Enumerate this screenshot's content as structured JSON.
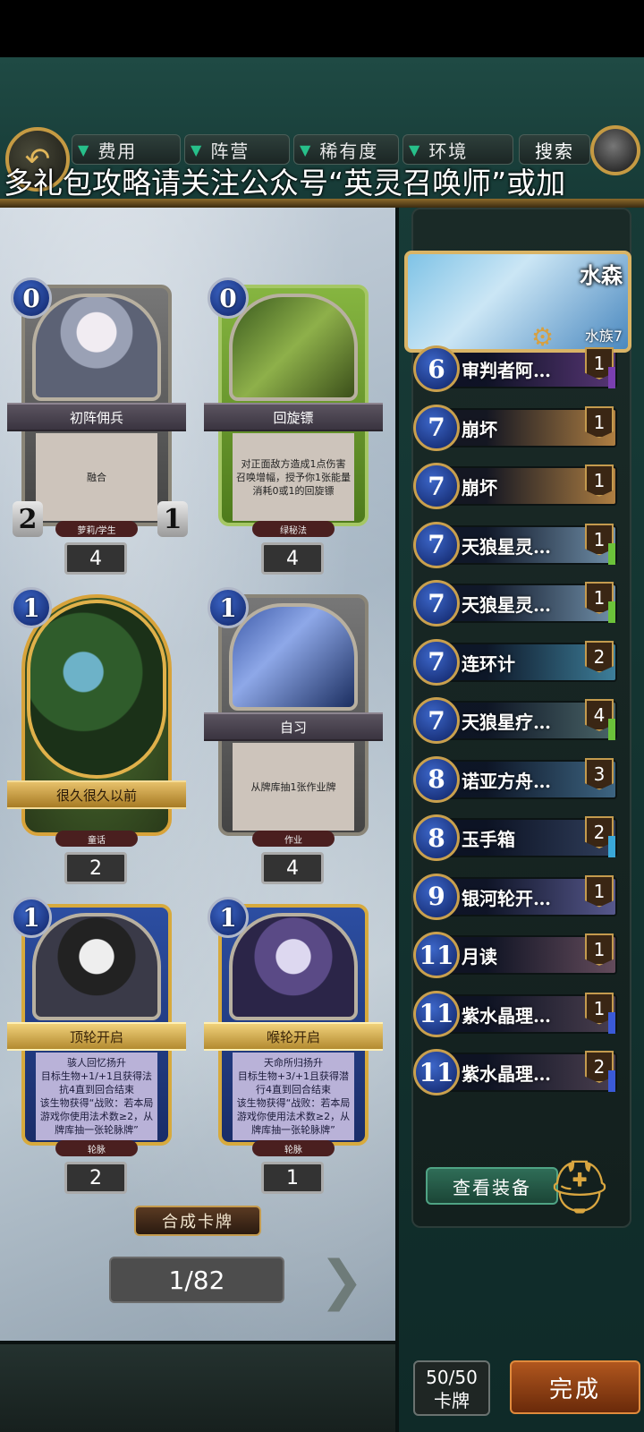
{
  "filters": {
    "cost": "费用",
    "faction": "阵营",
    "rarity": "稀有度",
    "environment": "环境",
    "search": "搜索"
  },
  "banner": "多礼包攻略请关注公众号“英灵召唤师”或加",
  "cards": [
    {
      "cost": "0",
      "name": "初阵佣兵",
      "desc": "融合",
      "tribe": "萝莉/学生",
      "atk": "2",
      "hp": "1",
      "count": "4"
    },
    {
      "cost": "0",
      "name": "回旋镖",
      "desc": "对正面敌方造成1点伤害\n召唤增幅，授予你1张能量消耗0或1的回旋镖",
      "tribe": "绿秘法",
      "count": "4"
    },
    {
      "cost": "1",
      "name": "很久很久以前",
      "tribe": "童话",
      "count": "2"
    },
    {
      "cost": "1",
      "name": "自习",
      "desc": "从牌库抽1张作业牌",
      "tribe": "作业",
      "count": "4"
    },
    {
      "cost": "1",
      "name": "顶轮开启",
      "desc": "骇人回忆扬升\n目标生物+1/+1且获得法抗4直到回合结束\n该生物获得“战败：若本局游戏你使用法术数≥2，从牌库抽一张轮脉牌”",
      "tribe": "轮脉",
      "count": "2"
    },
    {
      "cost": "1",
      "name": "喉轮开启",
      "desc": "天命所归扬升\n目标生物+3/+1且获得潜行4直到回合结束\n该生物获得“战败：若本局游戏你使用法术数≥2，从牌库抽一张轮脉牌”",
      "tribe": "轮脉",
      "count": "1"
    }
  ],
  "craft_label": "合成卡牌",
  "page": "1/82",
  "hero": {
    "name": "水森",
    "tag": "水族7"
  },
  "deck": [
    {
      "cost": "6",
      "name": "审判者阿…",
      "qty": "1",
      "color": "#6a3f8a",
      "rar": "#7a3fb0"
    },
    {
      "cost": "7",
      "name": "崩坏",
      "qty": "1",
      "color": "#d89a4a",
      "rar": ""
    },
    {
      "cost": "7",
      "name": "崩坏",
      "qty": "1",
      "color": "#d89a4a",
      "rar": ""
    },
    {
      "cost": "7",
      "name": "天狼星灵…",
      "qty": "1",
      "color": "#8ab0cc",
      "rar": "#6bc23a"
    },
    {
      "cost": "7",
      "name": "天狼星灵…",
      "qty": "1",
      "color": "#8ab0cc",
      "rar": "#6bc23a"
    },
    {
      "cost": "7",
      "name": "连环计",
      "qty": "2",
      "color": "#4a9ab8",
      "rar": ""
    },
    {
      "cost": "7",
      "name": "天狼星疗…",
      "qty": "4",
      "color": "#5a7a7a",
      "rar": "#6bc23a"
    },
    {
      "cost": "8",
      "name": "诺亚方舟…",
      "qty": "3",
      "color": "#4a7a9a",
      "rar": ""
    },
    {
      "cost": "8",
      "name": "玉手箱",
      "qty": "2",
      "color": "#3a4a6a",
      "rar": "#3aa8d8"
    },
    {
      "cost": "9",
      "name": "银河轮开…",
      "qty": "1",
      "color": "#6a6aa8",
      "rar": ""
    },
    {
      "cost": "11",
      "name": "月读",
      "qty": "1",
      "color": "#7a5a6a",
      "rar": ""
    },
    {
      "cost": "11",
      "name": "紫水晶理…",
      "qty": "1",
      "color": "#5a4a5a",
      "rar": "#3a5ad8"
    },
    {
      "cost": "11",
      "name": "紫水晶理…",
      "qty": "2",
      "color": "#5a4a5a",
      "rar": "#3a5ad8"
    }
  ],
  "equip_label": "查看装备",
  "deck_count": {
    "value": "50/50",
    "unit": "卡牌"
  },
  "done_label": "完成"
}
